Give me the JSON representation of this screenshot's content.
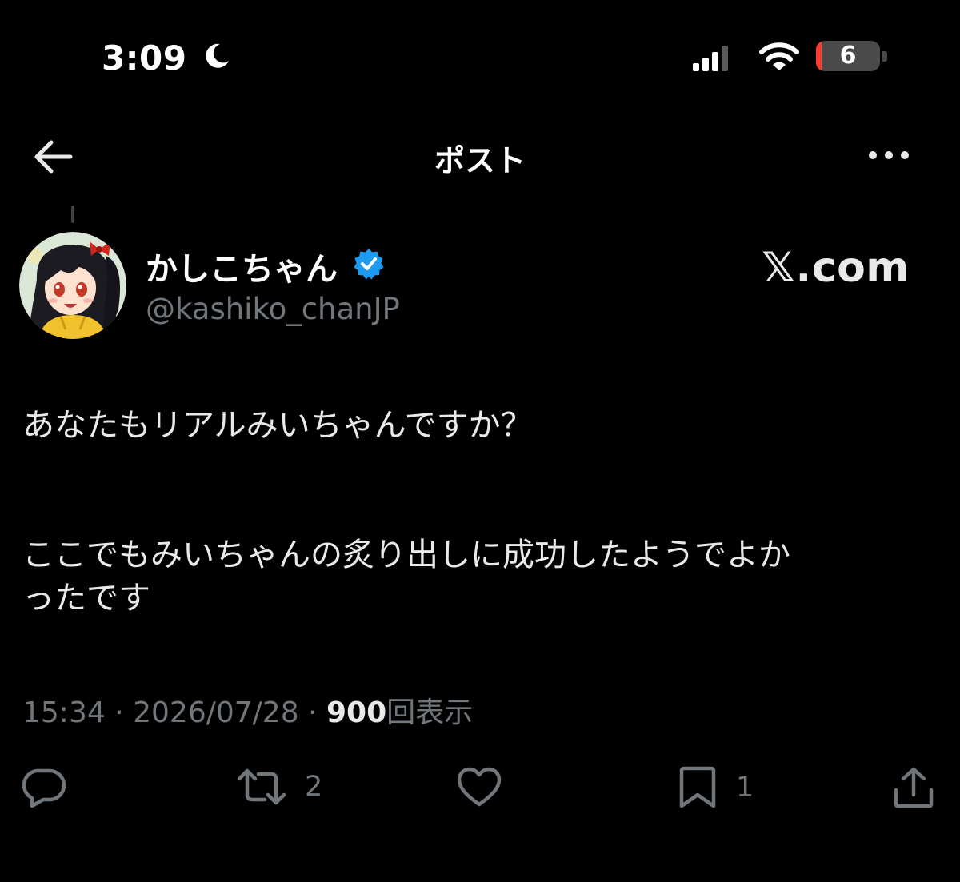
{
  "status_bar": {
    "time": "3:09",
    "battery_level": "6",
    "battery_color": "#ff3b30"
  },
  "nav": {
    "title": "ポスト",
    "back_icon": "arrow-left-icon",
    "more_icon": "more-horizontal-icon"
  },
  "post": {
    "author": {
      "display_name": "かしこちゃん",
      "handle": "@kashiko_chanJP",
      "verified": true,
      "verified_color": "#1d9bf0"
    },
    "watermark": "𝕏.com",
    "body": {
      "paragraph1": "あなたもリアルみいちゃんですか？",
      "paragraph2_line1": "ここでもみいちゃんの炙り出しに成功したようでよか",
      "paragraph2_line2": "ったです"
    },
    "meta": {
      "time": "15:34",
      "separator": "·",
      "date": "2026/07/28",
      "views_count": "900",
      "views_label": "回表示"
    },
    "actions": {
      "reply_count": "",
      "repost_count": "2",
      "like_count": "",
      "bookmark_count": "1"
    }
  }
}
